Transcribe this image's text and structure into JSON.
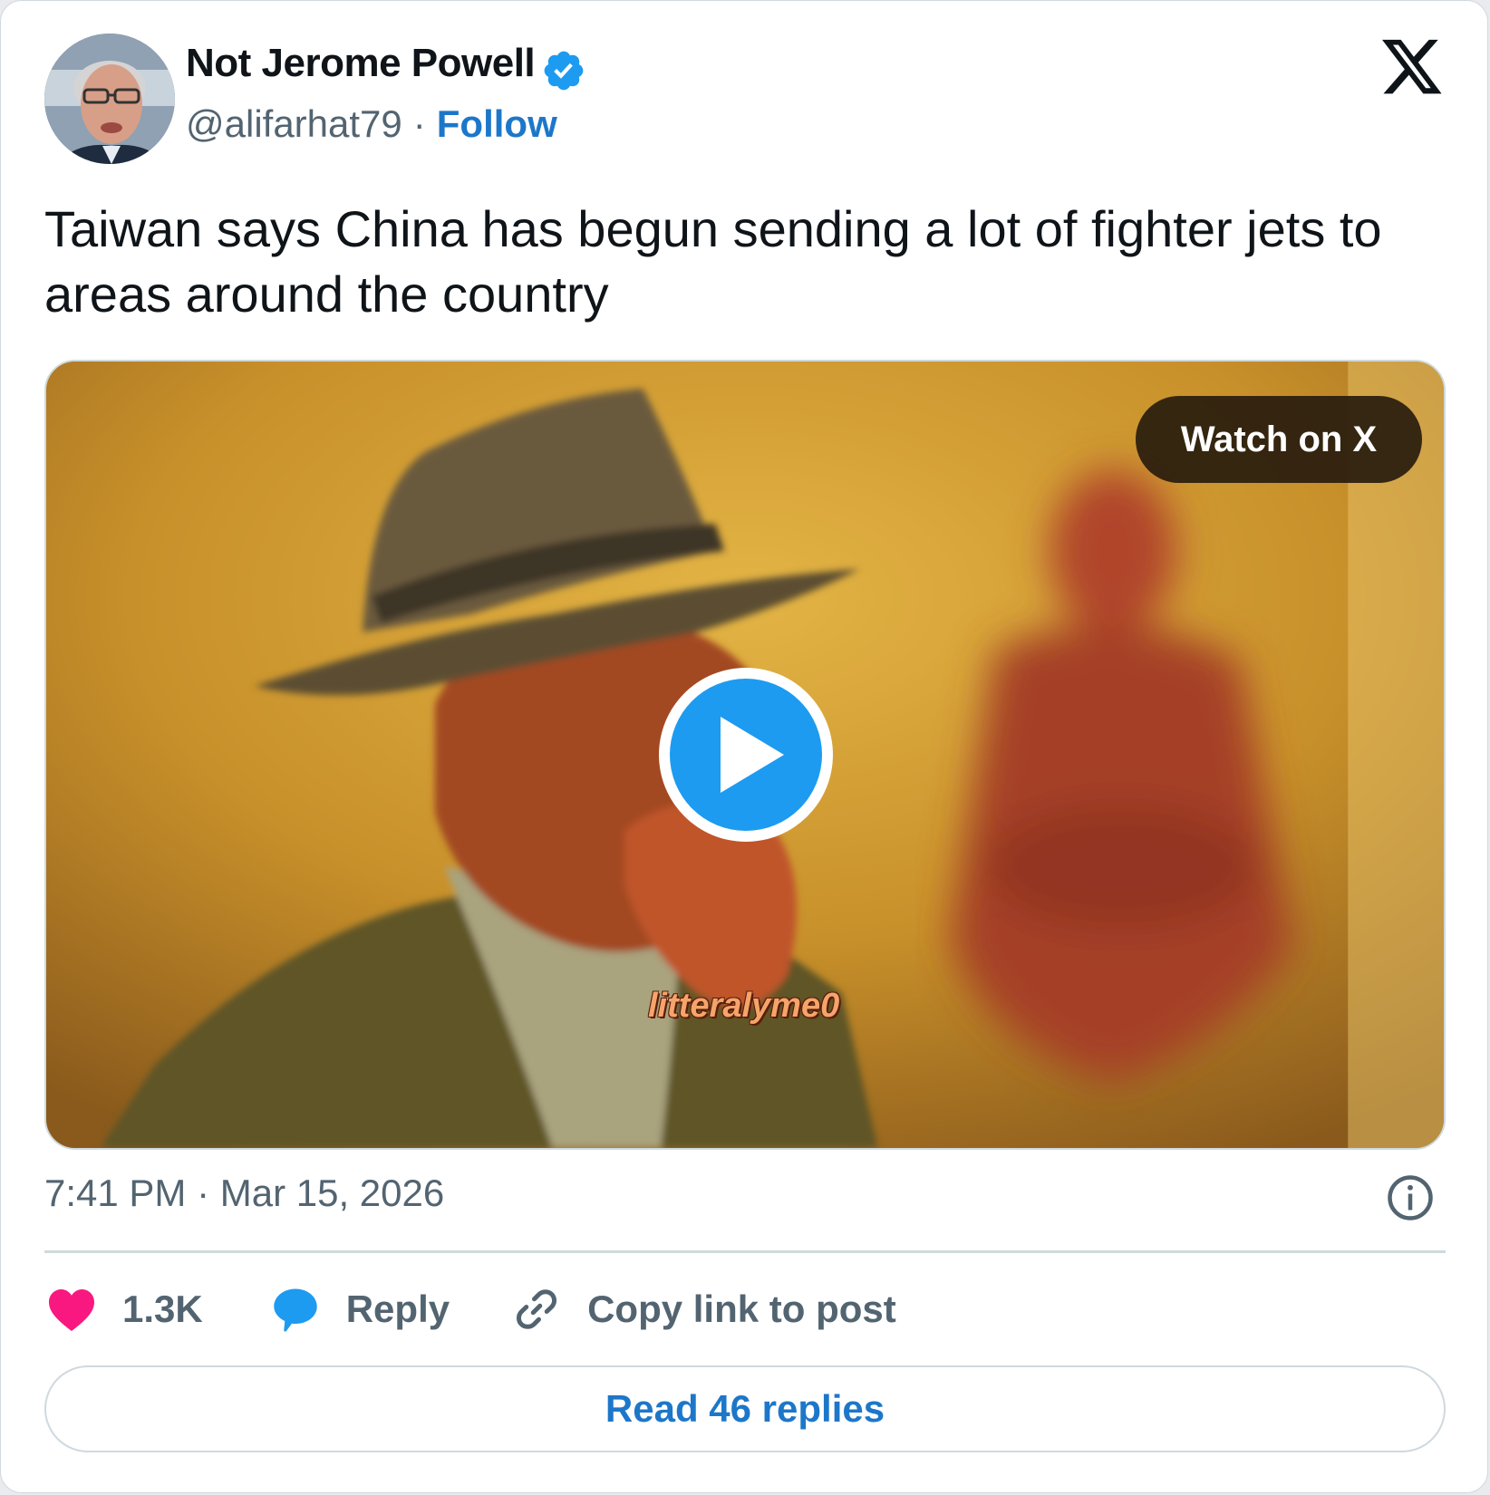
{
  "author": {
    "display_name": "Not Jerome Powell",
    "handle": "@alifarhat79",
    "separator": "·",
    "follow_label": "Follow",
    "verified": true,
    "avatar_icon": "avatar-photo"
  },
  "brand_icon": "x-logo-icon",
  "tweet": {
    "text": "Taiwan says China has begun sending a lot of fighter jets to areas around the country"
  },
  "media": {
    "type": "video",
    "watch_label": "Watch on X",
    "watermark": "litteralyme0",
    "play_icon": "play-icon"
  },
  "meta": {
    "timestamp": "7:41 PM · Mar 15, 2026",
    "info_icon": "info-icon"
  },
  "actions": {
    "like_count": "1.3K",
    "reply_label": "Reply",
    "copy_label": "Copy link to post"
  },
  "footer": {
    "read_replies_label": "Read 46 replies"
  },
  "colors": {
    "link": "#1d77c9",
    "verified": "#1d9bf0",
    "like": "#f91880",
    "reply": "#1d9bf0",
    "text_primary": "#0f1419",
    "text_secondary": "#536471",
    "border": "#cfd9de"
  }
}
